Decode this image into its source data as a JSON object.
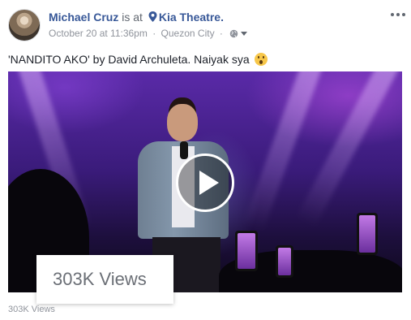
{
  "post": {
    "author": "Michael Cruz",
    "is_at": "is at",
    "place": "Kia Theatre.",
    "date": "October 20 at 11:36pm",
    "separator": "·",
    "location": "Quezon City",
    "privacy_separator": "·",
    "caption": "'NANDITO AKO' by David Archuleta. Naiyak sya",
    "caption_emoji": "astonished-face-emoji"
  },
  "icons": {
    "location_pin": "location-pin-icon",
    "privacy": "globe-icon",
    "dropdown": "chevron-down-icon",
    "more": "more-options-icon",
    "play": "play-icon"
  },
  "video": {
    "views_overlay": "303K Views",
    "views_count": "303K Views"
  },
  "colors": {
    "link": "#385898",
    "meta": "#90949c",
    "text": "#1d2129"
  }
}
